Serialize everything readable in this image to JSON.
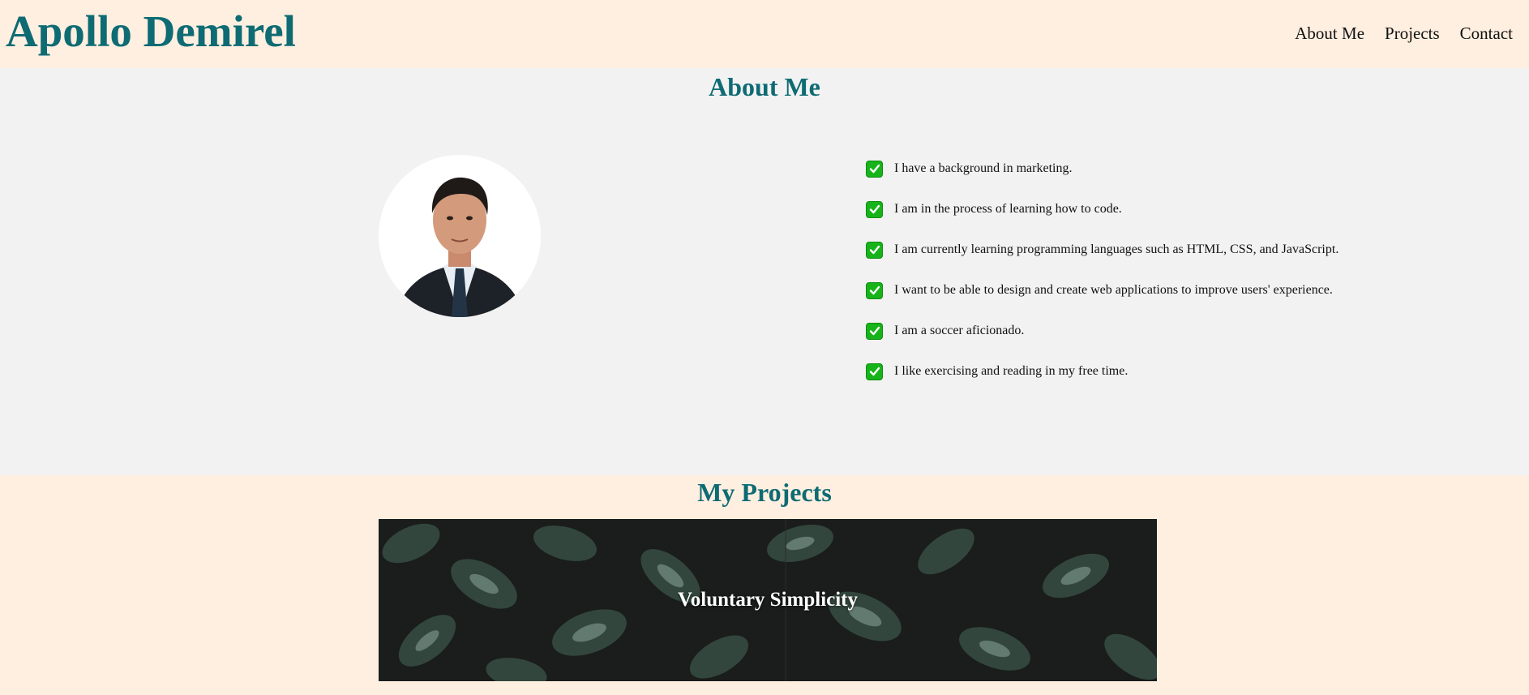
{
  "header": {
    "site_title": "Apollo Demirel",
    "nav": [
      "About Me",
      "Projects",
      "Contact"
    ]
  },
  "about": {
    "title": "About Me",
    "facts": [
      "I have a background in marketing.",
      "I am in the process of learning how to code.",
      "I am currently learning programming languages such as HTML, CSS, and JavaScript.",
      "I want to be able to design and create web applications to improve users' experience.",
      "I am a soccer aficionado.",
      "I like exercising and reading in my free time."
    ]
  },
  "projects": {
    "title": "My Projects",
    "cards": [
      {
        "title": "Voluntary Simplicity"
      }
    ]
  },
  "colors": {
    "accent": "#0e6b73",
    "header_bg": "#ffefe0",
    "about_bg": "#f2f2f2",
    "check": "#17b31a"
  }
}
